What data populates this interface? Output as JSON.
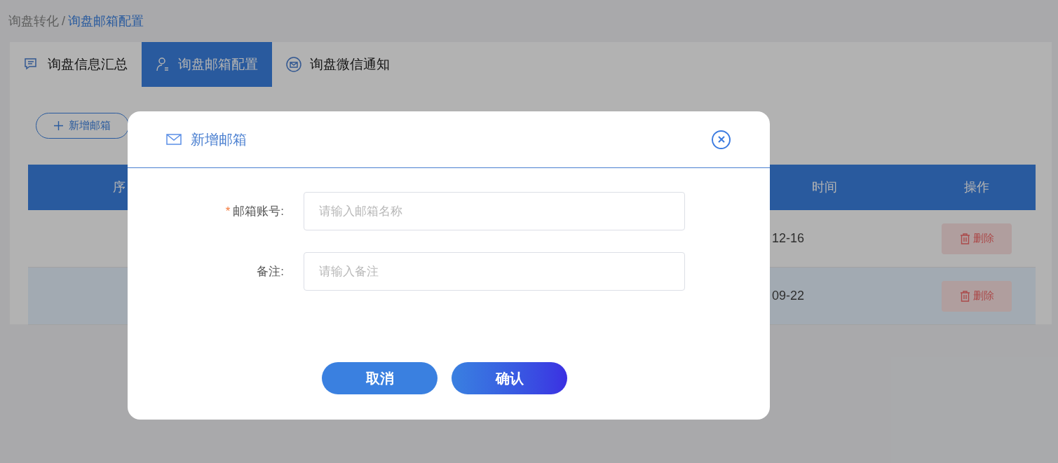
{
  "breadcrumb": {
    "separator": "/",
    "items": [
      {
        "text": "询盘转化",
        "selected": false
      },
      {
        "text": "询盘邮箱配置",
        "selected": true
      }
    ]
  },
  "tabs": [
    {
      "label": "询盘信息汇总",
      "selected": false
    },
    {
      "label": "询盘邮箱配置",
      "selected": true
    },
    {
      "label": "询盘微信通知",
      "selected": false
    }
  ],
  "add_button": {
    "label": "新增邮箱"
  },
  "table": {
    "columns": [
      "序",
      "时间",
      "操作"
    ],
    "rows": [
      {
        "column_2": "12-16",
        "action": "删除",
        "highlighted": false
      },
      {
        "column_2": "09-22",
        "action": "删除",
        "highlighted": true
      }
    ]
  },
  "dialog": {
    "title": "新增邮箱",
    "required_mark": "*",
    "fields": [
      {
        "label": "邮箱账号:",
        "required": true,
        "placeholder": "请输入邮箱名称"
      },
      {
        "label": "备注:",
        "required": false,
        "placeholder": "请输入备注"
      }
    ],
    "buttons": [
      {
        "label": "取消",
        "kind": "cancel"
      },
      {
        "label": "确认",
        "kind": "confirm"
      }
    ]
  }
}
